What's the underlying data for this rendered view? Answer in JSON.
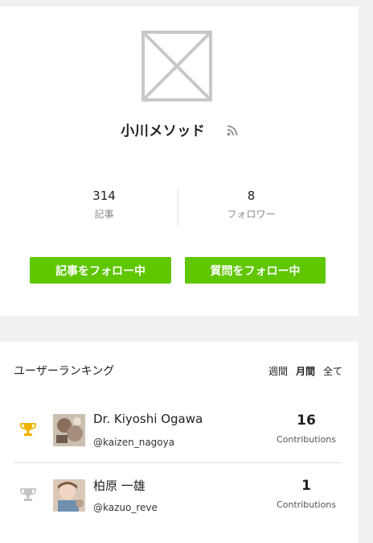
{
  "profile": {
    "name": "小川メソッド",
    "stats": [
      {
        "value": "314",
        "label": "記事"
      },
      {
        "value": "8",
        "label": "フォロワー"
      }
    ],
    "follow_article_label": "記事をフォロー中",
    "follow_question_label": "質問をフォロー中",
    "accent_color": "#5fc600"
  },
  "ranking": {
    "title": "ユーザーランキング",
    "periods": [
      "週間",
      "月間",
      "全て"
    ],
    "active_period": "月間",
    "users": [
      {
        "name": "Dr. Kiyoshi Ogawa",
        "handle": "@kaizen_nagoya",
        "contributions": "16",
        "contrib_label": "Contributions",
        "trophy": "gold-trophy-icon"
      },
      {
        "name": "柏原 一雄",
        "handle": "@kazuo_reve",
        "contributions": "1",
        "contrib_label": "Contributions",
        "trophy": "silver-trophy-icon"
      }
    ]
  }
}
